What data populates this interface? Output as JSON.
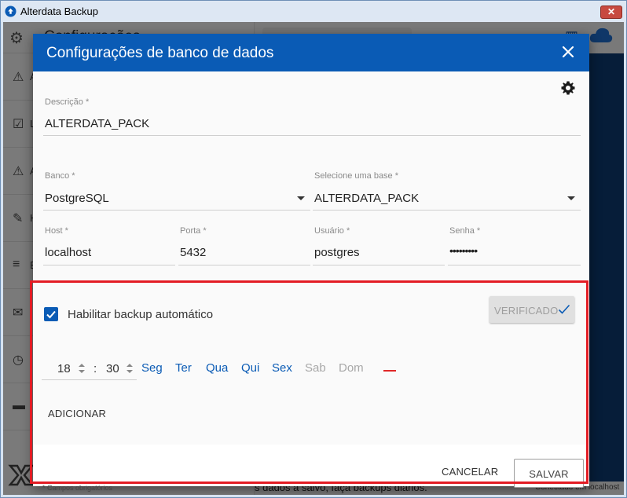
{
  "window": {
    "title": "Alterdata Backup",
    "close_glyph": "✕"
  },
  "background": {
    "sidebar_heading": "Configurações",
    "sidebar_items": [
      {
        "icon": "warning-icon",
        "glyph": "⚠",
        "label": "A"
      },
      {
        "icon": "calendar-check-icon",
        "glyph": "☑",
        "label": "L"
      },
      {
        "icon": "warning-icon",
        "glyph": "⚠",
        "label": "A"
      },
      {
        "icon": "wand-icon",
        "glyph": "✎",
        "label": "H"
      },
      {
        "icon": "database-icon",
        "glyph": "≡",
        "label": "B"
      },
      {
        "icon": "mail-icon",
        "glyph": "✉",
        "label": ""
      },
      {
        "icon": "clock-icon",
        "glyph": "◷",
        "label": ""
      },
      {
        "icon": "folder-icon",
        "glyph": "▬",
        "label": ""
      }
    ],
    "bottom_text": "s dados a salvo, faça backups diários.",
    "connected_text": "Conectado em localhost"
  },
  "dialog": {
    "title": "Configurações de banco de dados",
    "descricao": {
      "label": "Descrição *",
      "value": "ALTERDATA_PACK"
    },
    "banco": {
      "label": "Banco *",
      "value": "PostgreSQL"
    },
    "base": {
      "label": "Selecione uma base *",
      "value": "ALTERDATA_PACK"
    },
    "host": {
      "label": "Host *",
      "value": "localhost"
    },
    "porta": {
      "label": "Porta *",
      "value": "5432"
    },
    "usuario": {
      "label": "Usuário *",
      "value": "postgres"
    },
    "senha": {
      "label": "Senha *",
      "value": "•••••••••"
    },
    "auto_backup": {
      "checkbox_label": "Habilitar backup automático",
      "checked": true,
      "verify_button": "VERIFICADO",
      "schedule": {
        "hour": "18",
        "separator": ":",
        "minute": "30",
        "days": [
          {
            "label": "Seg",
            "active": true
          },
          {
            "label": "Ter",
            "active": true
          },
          {
            "label": "Qua",
            "active": true
          },
          {
            "label": "Qui",
            "active": true
          },
          {
            "label": "Sex",
            "active": true
          },
          {
            "label": "Sab",
            "active": false
          },
          {
            "label": "Dom",
            "active": false
          }
        ]
      },
      "add_button": "ADICIONAR"
    },
    "required_note": "* Campos obrigatórios",
    "cancel_button": "CANCELAR",
    "save_button": "SALVAR"
  },
  "colors": {
    "primary": "#0a5bb5",
    "annotation": "#e31c24",
    "remove": "#e02828",
    "day_inactive": "#a8a8a8"
  }
}
